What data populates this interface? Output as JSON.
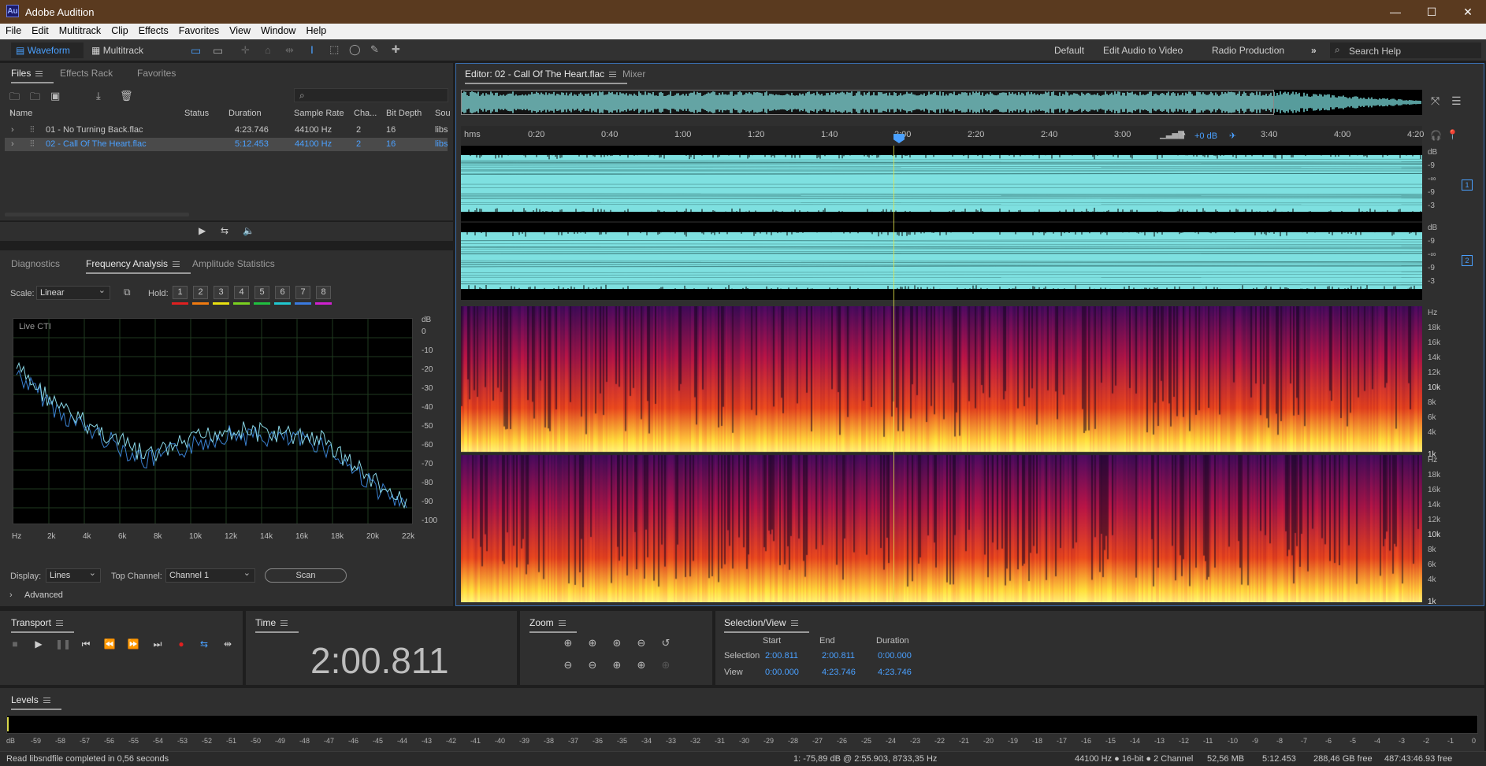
{
  "app": {
    "title": "Adobe Audition",
    "logo": "Au",
    "window_controls": [
      "minimize-icon",
      "maximize-icon",
      "close-icon"
    ]
  },
  "menu": [
    "File",
    "Edit",
    "Multitrack",
    "Clip",
    "Effects",
    "Favorites",
    "View",
    "Window",
    "Help"
  ],
  "toolbar": {
    "waveform_label": "Waveform",
    "multitrack_label": "Multitrack",
    "workspaces": [
      "Default",
      "Edit Audio to Video",
      "Radio Production"
    ],
    "search_placeholder": "Search Help"
  },
  "files_panel": {
    "tabs": [
      "Files",
      "Effects Rack",
      "Favorites"
    ],
    "columns": [
      "Name",
      "Status",
      "Duration",
      "Sample Rate",
      "Cha...",
      "Bit Depth",
      "Sou"
    ],
    "rows": [
      {
        "name": "01 - No Turning Back.flac",
        "status": "",
        "duration": "4:23.746",
        "sample_rate": "44100 Hz",
        "channels": "2",
        "bit_depth": "16",
        "source": "libs"
      },
      {
        "name": "02 - Call Of The Heart.flac",
        "status": "",
        "duration": "5:12.453",
        "sample_rate": "44100 Hz",
        "channels": "2",
        "bit_depth": "16",
        "source": "libs"
      }
    ]
  },
  "analysis_panel": {
    "tabs": [
      "Diagnostics",
      "Frequency Analysis",
      "Amplitude Statistics"
    ],
    "scale_label": "Scale:",
    "scale_value": "Linear",
    "hold_label": "Hold:",
    "holds": [
      "1",
      "2",
      "3",
      "4",
      "5",
      "6",
      "7",
      "8"
    ],
    "hold_colors": [
      "#e02020",
      "#f07a10",
      "#e8e010",
      "#7ad020",
      "#20c040",
      "#20c8d0",
      "#3a7ae0",
      "#d020d0"
    ],
    "graph_label": "Live CTI",
    "db_unit": "dB",
    "db_ticks": [
      "0",
      "-10",
      "-20",
      "-30",
      "-40",
      "-50",
      "-60",
      "-70",
      "-80",
      "-90",
      "-100"
    ],
    "hz_ticks": [
      "Hz",
      "2k",
      "4k",
      "6k",
      "8k",
      "10k",
      "12k",
      "14k",
      "16k",
      "18k",
      "20k",
      "22k"
    ],
    "display_label": "Display:",
    "display_value": "Lines",
    "top_channel_label": "Top Channel:",
    "top_channel_value": "Channel 1",
    "scan_label": "Scan",
    "advanced_label": "Advanced"
  },
  "editor": {
    "tabs": [
      "Editor: 02 - Call Of The Heart.flac",
      "Mixer"
    ],
    "ruler_unit": "hms",
    "ruler_ticks": [
      "0:20",
      "0:40",
      "1:00",
      "1:20",
      "1:40",
      "2:00",
      "2:20",
      "2:40",
      "3:00",
      "3:20",
      "3:40",
      "4:00",
      "4:20"
    ],
    "gain_label": "+0 dB",
    "db_scale": [
      "dB",
      "-9",
      "-∞",
      "-9",
      "-3"
    ],
    "channel_badges": [
      "1",
      "2"
    ],
    "hz_scale": [
      "Hz",
      "18k",
      "16k",
      "14k",
      "12k",
      "10k",
      "8k",
      "6k",
      "4k",
      "1k"
    ]
  },
  "transport": {
    "title": "Transport"
  },
  "time_panel": {
    "title": "Time",
    "value": "2:00.811"
  },
  "zoom_panel": {
    "title": "Zoom"
  },
  "selection_panel": {
    "title": "Selection/View",
    "headers": [
      "Start",
      "End",
      "Duration"
    ],
    "rows": [
      {
        "label": "Selection",
        "start": "2:00.811",
        "end": "2:00.811",
        "duration": "0:00.000"
      },
      {
        "label": "View",
        "start": "0:00.000",
        "end": "4:23.746",
        "duration": "4:23.746"
      }
    ]
  },
  "levels": {
    "title": "Levels",
    "ticks": [
      "dB",
      "-59",
      "-58",
      "-57",
      "-56",
      "-55",
      "-54",
      "-53",
      "-52",
      "-51",
      "-50",
      "-49",
      "-48",
      "-47",
      "-46",
      "-45",
      "-44",
      "-43",
      "-42",
      "-41",
      "-40",
      "-39",
      "-38",
      "-37",
      "-36",
      "-35",
      "-34",
      "-33",
      "-32",
      "-31",
      "-30",
      "-29",
      "-28",
      "-27",
      "-26",
      "-25",
      "-24",
      "-23",
      "-22",
      "-21",
      "-20",
      "-19",
      "-18",
      "-17",
      "-16",
      "-15",
      "-14",
      "-13",
      "-12",
      "-11",
      "-10",
      "-9",
      "-8",
      "-7",
      "-6",
      "-5",
      "-4",
      "-3",
      "-2",
      "-1",
      "0"
    ]
  },
  "statusbar": {
    "message": "Read libsndfile completed in 0,56 seconds",
    "cursor": "1: -75,89 dB @ 2:55.903, 8733,35 Hz",
    "format": "44100 Hz ● 16-bit ● 2 Channel",
    "size": "52,56 MB",
    "duration": "5:12.453",
    "free": "288,46 GB free",
    "free_time": "487:43:46.93 free"
  }
}
